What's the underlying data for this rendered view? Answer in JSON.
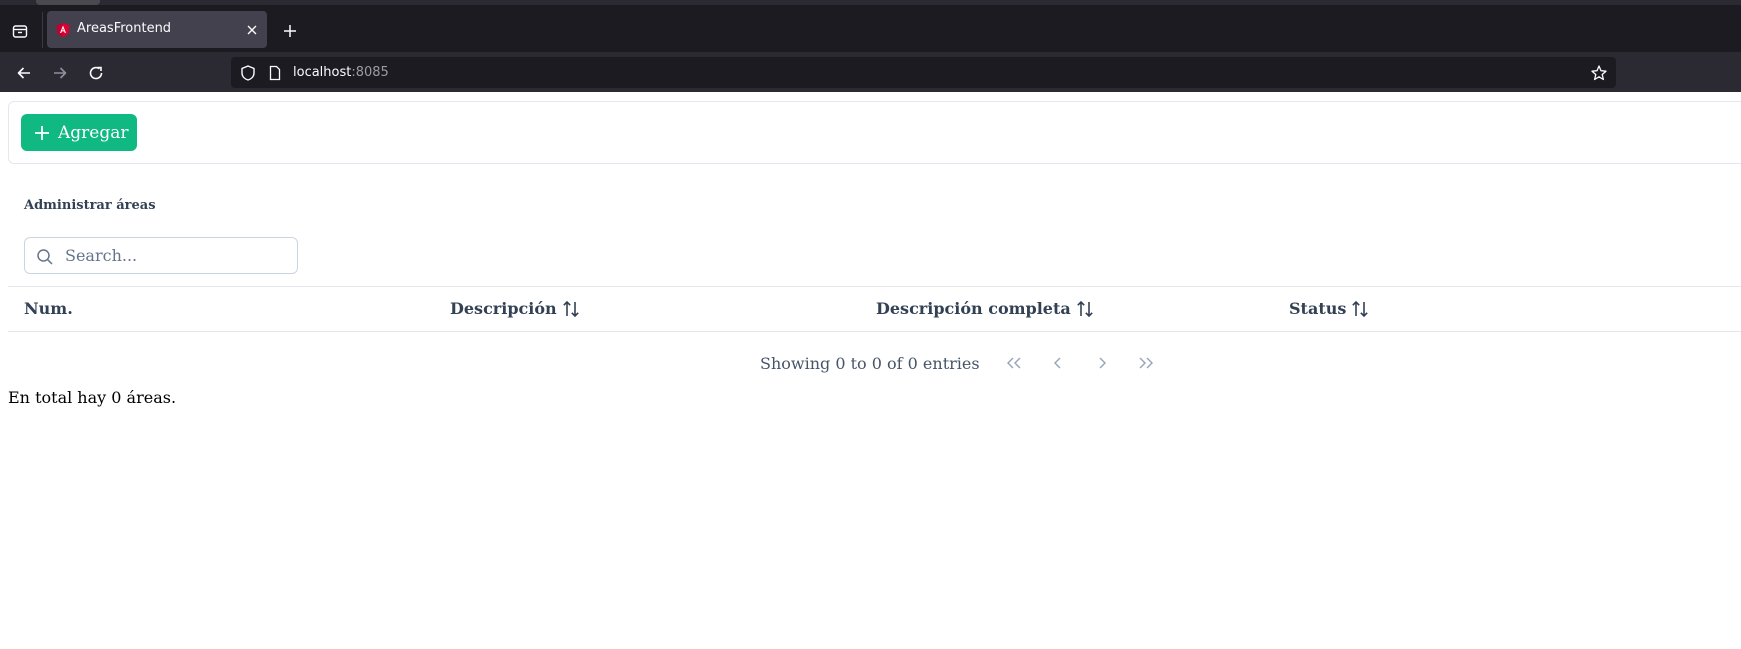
{
  "browser": {
    "tab_title": "AreasFrontend",
    "url_host": "localhost",
    "url_port": ":8085"
  },
  "toolbar": {
    "add_label": "Agregar"
  },
  "card": {
    "title": "Administrar áreas"
  },
  "search": {
    "placeholder": "Search..."
  },
  "table": {
    "columns": [
      "Num.",
      "Descripción",
      "Descripción completa",
      "Status"
    ]
  },
  "paginator": {
    "report": "Showing 0 to 0 of 0 entries"
  },
  "footer": {
    "total_text": "En total hay 0 áreas."
  },
  "colors": {
    "accent": "#10b981",
    "browser_tabstrip": "#1c1b22",
    "browser_navbar": "#2b2a33"
  },
  "icons": [
    "tabs-list-icon",
    "favicon-icon",
    "close-icon",
    "plus-icon",
    "back-icon",
    "forward-icon",
    "reload-icon",
    "shield-icon",
    "page-icon",
    "star-icon",
    "search-icon",
    "sort-icon",
    "first-page-icon",
    "prev-page-icon",
    "next-page-icon",
    "last-page-icon"
  ]
}
